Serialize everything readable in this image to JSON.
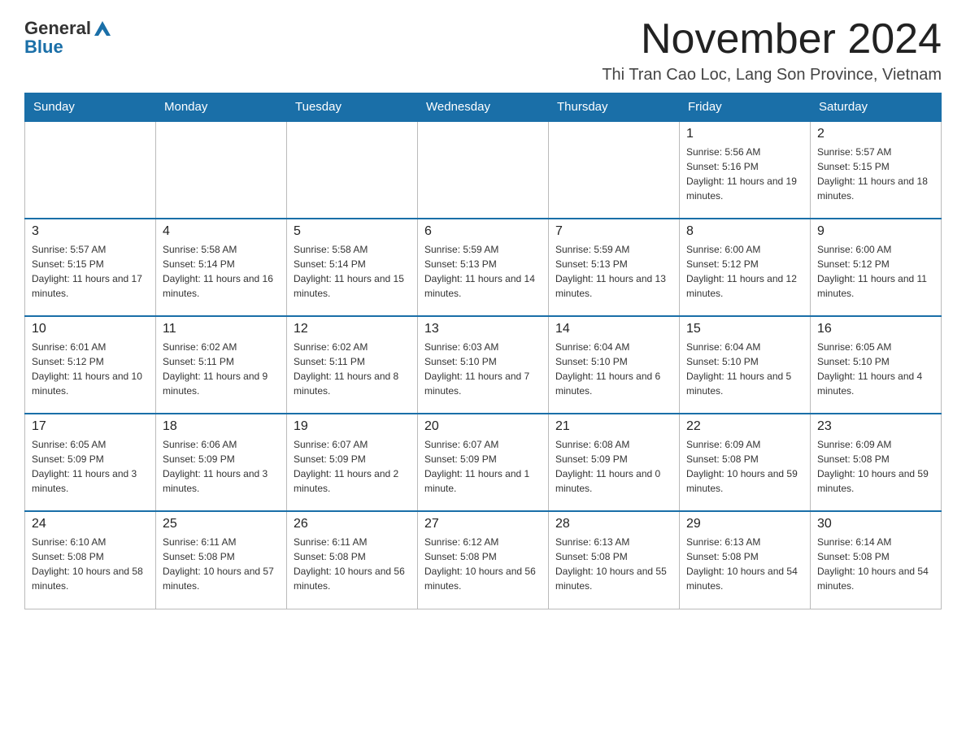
{
  "header": {
    "logo_general": "General",
    "logo_blue": "Blue",
    "month_title": "November 2024",
    "location": "Thi Tran Cao Loc, Lang Son Province, Vietnam"
  },
  "days_of_week": [
    "Sunday",
    "Monday",
    "Tuesday",
    "Wednesday",
    "Thursday",
    "Friday",
    "Saturday"
  ],
  "weeks": [
    [
      {
        "day": "",
        "info": ""
      },
      {
        "day": "",
        "info": ""
      },
      {
        "day": "",
        "info": ""
      },
      {
        "day": "",
        "info": ""
      },
      {
        "day": "",
        "info": ""
      },
      {
        "day": "1",
        "info": "Sunrise: 5:56 AM\nSunset: 5:16 PM\nDaylight: 11 hours and 19 minutes."
      },
      {
        "day": "2",
        "info": "Sunrise: 5:57 AM\nSunset: 5:15 PM\nDaylight: 11 hours and 18 minutes."
      }
    ],
    [
      {
        "day": "3",
        "info": "Sunrise: 5:57 AM\nSunset: 5:15 PM\nDaylight: 11 hours and 17 minutes."
      },
      {
        "day": "4",
        "info": "Sunrise: 5:58 AM\nSunset: 5:14 PM\nDaylight: 11 hours and 16 minutes."
      },
      {
        "day": "5",
        "info": "Sunrise: 5:58 AM\nSunset: 5:14 PM\nDaylight: 11 hours and 15 minutes."
      },
      {
        "day": "6",
        "info": "Sunrise: 5:59 AM\nSunset: 5:13 PM\nDaylight: 11 hours and 14 minutes."
      },
      {
        "day": "7",
        "info": "Sunrise: 5:59 AM\nSunset: 5:13 PM\nDaylight: 11 hours and 13 minutes."
      },
      {
        "day": "8",
        "info": "Sunrise: 6:00 AM\nSunset: 5:12 PM\nDaylight: 11 hours and 12 minutes."
      },
      {
        "day": "9",
        "info": "Sunrise: 6:00 AM\nSunset: 5:12 PM\nDaylight: 11 hours and 11 minutes."
      }
    ],
    [
      {
        "day": "10",
        "info": "Sunrise: 6:01 AM\nSunset: 5:12 PM\nDaylight: 11 hours and 10 minutes."
      },
      {
        "day": "11",
        "info": "Sunrise: 6:02 AM\nSunset: 5:11 PM\nDaylight: 11 hours and 9 minutes."
      },
      {
        "day": "12",
        "info": "Sunrise: 6:02 AM\nSunset: 5:11 PM\nDaylight: 11 hours and 8 minutes."
      },
      {
        "day": "13",
        "info": "Sunrise: 6:03 AM\nSunset: 5:10 PM\nDaylight: 11 hours and 7 minutes."
      },
      {
        "day": "14",
        "info": "Sunrise: 6:04 AM\nSunset: 5:10 PM\nDaylight: 11 hours and 6 minutes."
      },
      {
        "day": "15",
        "info": "Sunrise: 6:04 AM\nSunset: 5:10 PM\nDaylight: 11 hours and 5 minutes."
      },
      {
        "day": "16",
        "info": "Sunrise: 6:05 AM\nSunset: 5:10 PM\nDaylight: 11 hours and 4 minutes."
      }
    ],
    [
      {
        "day": "17",
        "info": "Sunrise: 6:05 AM\nSunset: 5:09 PM\nDaylight: 11 hours and 3 minutes."
      },
      {
        "day": "18",
        "info": "Sunrise: 6:06 AM\nSunset: 5:09 PM\nDaylight: 11 hours and 3 minutes."
      },
      {
        "day": "19",
        "info": "Sunrise: 6:07 AM\nSunset: 5:09 PM\nDaylight: 11 hours and 2 minutes."
      },
      {
        "day": "20",
        "info": "Sunrise: 6:07 AM\nSunset: 5:09 PM\nDaylight: 11 hours and 1 minute."
      },
      {
        "day": "21",
        "info": "Sunrise: 6:08 AM\nSunset: 5:09 PM\nDaylight: 11 hours and 0 minutes."
      },
      {
        "day": "22",
        "info": "Sunrise: 6:09 AM\nSunset: 5:08 PM\nDaylight: 10 hours and 59 minutes."
      },
      {
        "day": "23",
        "info": "Sunrise: 6:09 AM\nSunset: 5:08 PM\nDaylight: 10 hours and 59 minutes."
      }
    ],
    [
      {
        "day": "24",
        "info": "Sunrise: 6:10 AM\nSunset: 5:08 PM\nDaylight: 10 hours and 58 minutes."
      },
      {
        "day": "25",
        "info": "Sunrise: 6:11 AM\nSunset: 5:08 PM\nDaylight: 10 hours and 57 minutes."
      },
      {
        "day": "26",
        "info": "Sunrise: 6:11 AM\nSunset: 5:08 PM\nDaylight: 10 hours and 56 minutes."
      },
      {
        "day": "27",
        "info": "Sunrise: 6:12 AM\nSunset: 5:08 PM\nDaylight: 10 hours and 56 minutes."
      },
      {
        "day": "28",
        "info": "Sunrise: 6:13 AM\nSunset: 5:08 PM\nDaylight: 10 hours and 55 minutes."
      },
      {
        "day": "29",
        "info": "Sunrise: 6:13 AM\nSunset: 5:08 PM\nDaylight: 10 hours and 54 minutes."
      },
      {
        "day": "30",
        "info": "Sunrise: 6:14 AM\nSunset: 5:08 PM\nDaylight: 10 hours and 54 minutes."
      }
    ]
  ]
}
